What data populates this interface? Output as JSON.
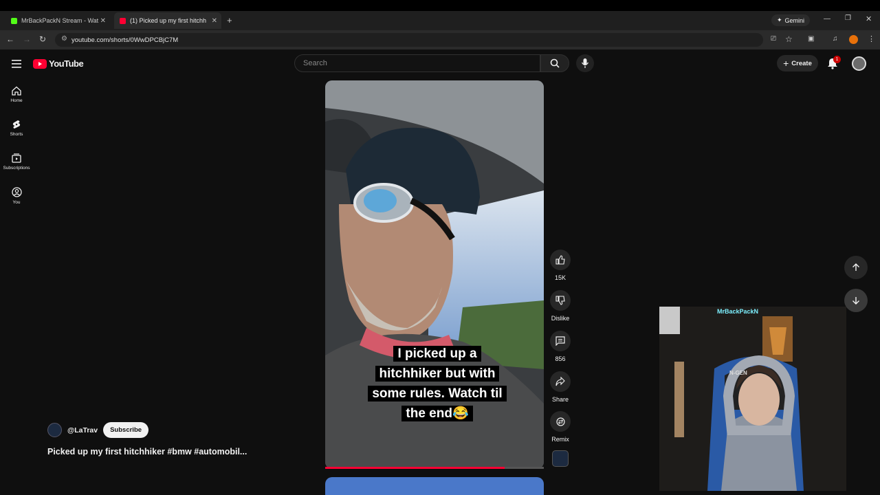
{
  "browser": {
    "tabs": [
      {
        "label": "MrBackPackN Stream - Wat",
        "favicon_color": "#53fc18"
      },
      {
        "label": "(1) Picked up my first hitchh",
        "favicon_color": "#ff0033"
      }
    ],
    "url": "youtube.com/shorts/0WwDPCBjC7M",
    "gemini_label": "Gemini"
  },
  "youtube": {
    "logo_text": "YouTube",
    "search_placeholder": "Search",
    "create_label": "Create",
    "notification_count": "1",
    "sidebar": [
      {
        "label": "Home",
        "icon": "home-icon"
      },
      {
        "label": "Shorts",
        "icon": "shorts-icon"
      },
      {
        "label": "Subscriptions",
        "icon": "subscriptions-icon"
      },
      {
        "label": "You",
        "icon": "you-icon"
      }
    ],
    "short": {
      "caption": "I picked up a hitchhiker but with some rules. Watch til the end😂",
      "progress": 0.82,
      "channel": "@LaTrav",
      "subscribe_label": "Subscribe",
      "title": "Picked up my first hitchhiker #bmw #automobil..."
    },
    "actions": {
      "likes": "15K",
      "dislike_label": "Dislike",
      "comments": "856",
      "share_label": "Share",
      "remix_label": "Remix"
    }
  },
  "overlay": {
    "webcam_name": "MrBackPackN",
    "chair_brand": "N-GEN"
  },
  "colors": {
    "accent": "#ff0033",
    "background": "#0f0f0f"
  }
}
